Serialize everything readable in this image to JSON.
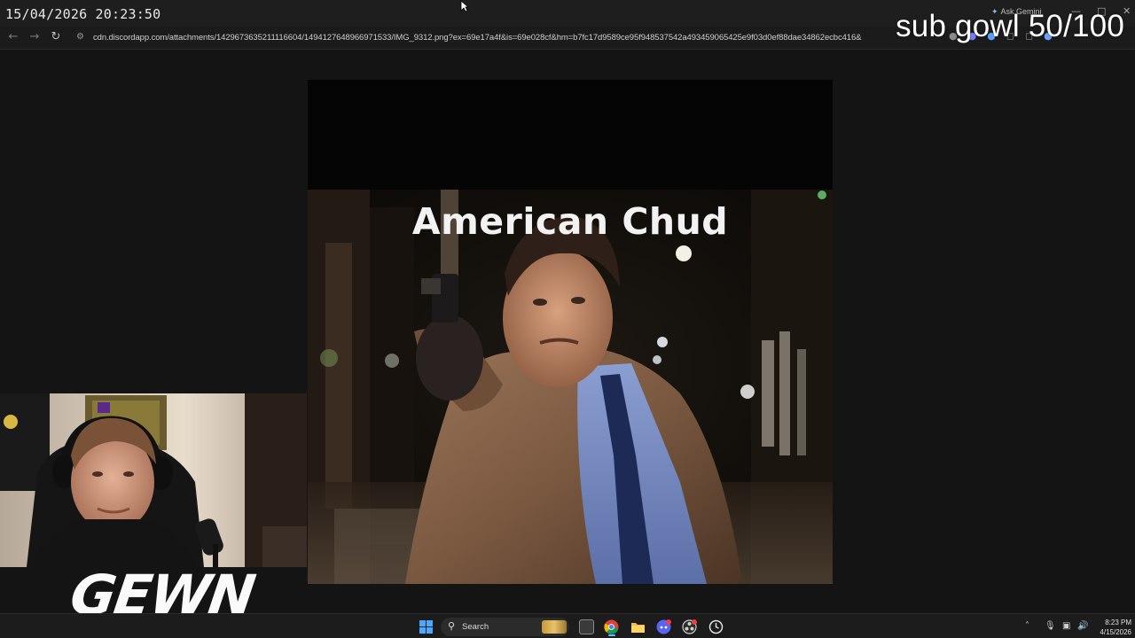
{
  "overlay": {
    "timestamp": "15/04/2026 20:23:50",
    "sub_goal": "sub gowl 50/100",
    "channel_logo_text": "GEWN"
  },
  "browser": {
    "url": "cdn.discordapp.com/attachments/1429673635211116604/1494127648966971533/IMG_9312.png?ex=69e17a4f&is=69e028cf&hm=b7fc17d9589ce95f948537542a493459065425e9f03d0ef88dae34862ecbc416&",
    "ask_gemini_label": "Ask Gemini",
    "icons": [
      "back-arrow-icon",
      "forward-arrow-icon",
      "reload-icon",
      "site-info-icon"
    ]
  },
  "meme": {
    "caption": "American Chud",
    "colors": {
      "background": "#050505",
      "caption": "#f2f2f2"
    }
  },
  "taskbar": {
    "search_label": "Search",
    "time": "8:23 PM",
    "date": "4/15/2026",
    "apps": [
      "start-icon",
      "task-view-icon",
      "chrome-icon",
      "file-explorer-icon",
      "discord-icon",
      "obs-icon",
      "clock-icon"
    ],
    "accent": "#6cb6ff"
  }
}
